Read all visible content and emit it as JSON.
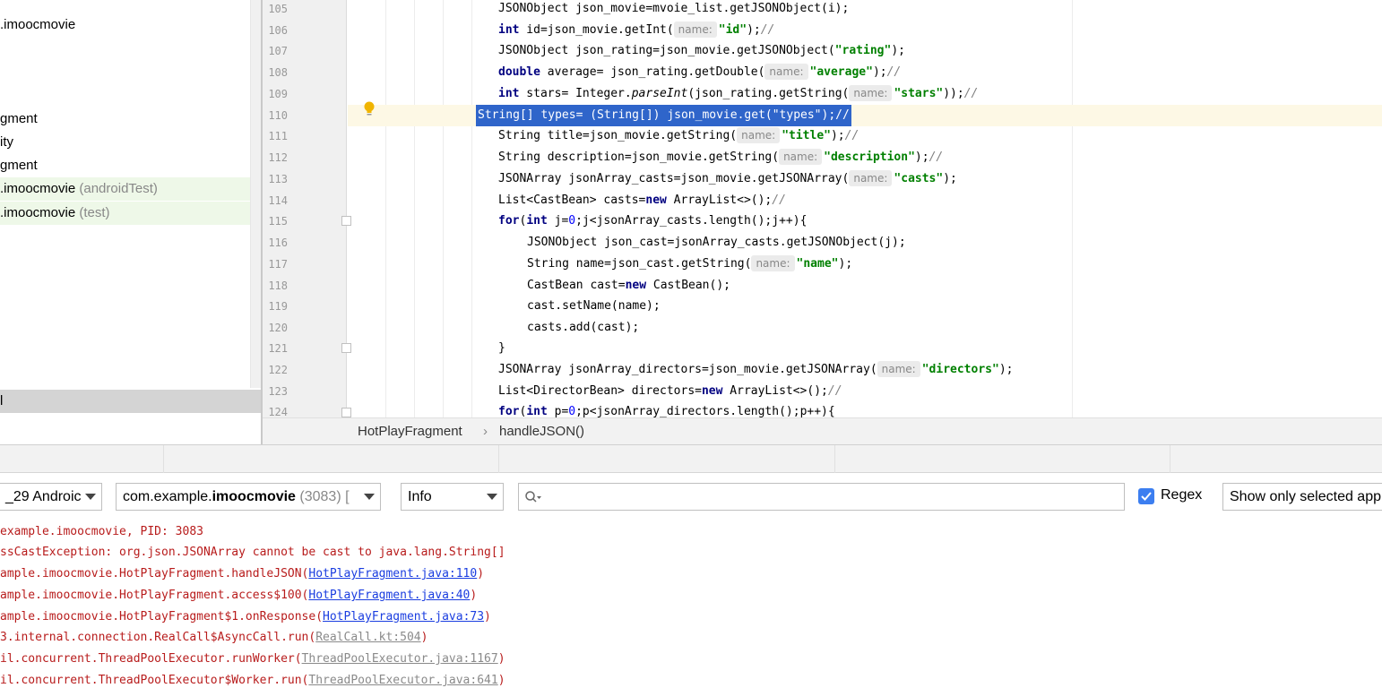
{
  "tree": {
    "items": [
      {
        "label": ".imoocmovie",
        "suffix": ""
      },
      {
        "label": "gment",
        "suffix": ""
      },
      {
        "label": "ity",
        "suffix": ""
      },
      {
        "label": "gment",
        "suffix": ""
      },
      {
        "label": ".imoocmovie",
        "suffix": " (androidTest)"
      },
      {
        "label": ".imoocmovie",
        "suffix": " (test)"
      }
    ],
    "selected_label": "l"
  },
  "editor": {
    "line_numbers": [
      "105",
      "106",
      "107",
      "108",
      "109",
      "110",
      "111",
      "112",
      "113",
      "114",
      "115",
      "116",
      "117",
      "118",
      "119",
      "120",
      "121",
      "122",
      "123",
      "124"
    ],
    "hint_name": "name:",
    "code": {
      "l105": "JSONObject json_movie=mvoie_list.getJSONObject(i);",
      "l106a": "int",
      "l106b": " id=json_movie.getInt(",
      "l106s": "\"id\"",
      "l106c": ");",
      "l106d": "//",
      "l107a": "JSONObject json_rating=json_movie.getJSONObject(",
      "l107s": "\"rating\"",
      "l107b": ");",
      "l108a": "double",
      "l108b": " average= json_rating.getDouble(",
      "l108s": "\"average\"",
      "l108c": ");",
      "l108d": "//",
      "l109a": "int",
      "l109b": " stars= Integer.",
      "l109i": "parseInt",
      "l109c": "(json_rating.getString(",
      "l109s": "\"stars\"",
      "l109d": "));",
      "l109e": "//",
      "l110": "String[] types= (String[]) json_movie.get(\"types\");//",
      "l111a": "String title=json_movie.getString(",
      "l111s": "\"title\"",
      "l111b": ");",
      "l111c": "//",
      "l112a": "String description=json_movie.getString(",
      "l112s": "\"description\"",
      "l112b": ");",
      "l112c": "//",
      "l113a": "JSONArray jsonArray_casts=json_movie.getJSONArray(",
      "l113s": "\"casts\"",
      "l113b": ");",
      "l114a": "List<CastBean> casts=",
      "l114k": "new",
      "l114b": " ArrayList<>();",
      "l114c": "//",
      "l115a": "for",
      "l115b": "(",
      "l115k": "int",
      "l115c": " j=",
      "l115n": "0",
      "l115d": ";j<jsonArray_casts.length();j++){",
      "l116": "JSONObject json_cast=jsonArray_casts.getJSONObject(j);",
      "l117a": "String name=json_cast.getString(",
      "l117s": "\"name\"",
      "l117b": ");",
      "l118a": "CastBean cast=",
      "l118k": "new",
      "l118b": " CastBean();",
      "l119": "cast.setName(name);",
      "l120": "casts.add(cast);",
      "l121": "}",
      "l122a": "JSONArray jsonArray_directors=json_movie.getJSONArray(",
      "l122s": "\"directors\"",
      "l122b": ");",
      "l123a": "List<DirectorBean> directors=",
      "l123k": "new",
      "l123b": " ArrayList<>();",
      "l123c": "//",
      "l124a": "for",
      "l124b": "(",
      "l124k": "int",
      "l124c": " p=",
      "l124n": "0",
      "l124d": ";p<jsonArray_directors.length();p++){"
    }
  },
  "breadcrumb": {
    "class_name": "HotPlayFragment",
    "separator": "›",
    "method_name": "handleJSON()"
  },
  "logcat": {
    "device_combo": "_29 Androic",
    "process_combo_prefix": "com.example.",
    "process_combo_bold": "imoocmovie",
    "process_combo_suffix": " (3083) [",
    "level_combo": "Info",
    "regex_label": "Regex",
    "show_only_label": "Show only selected app",
    "lines": [
      {
        "text": "example.imoocmovie, PID: 3083",
        "link": "",
        "tail": ""
      },
      {
        "text": "ssCastException: org.json.JSONArray cannot be cast to java.lang.String[]",
        "link": "",
        "tail": ""
      },
      {
        "text": "ample.imoocmovie.HotPlayFragment.handleJSON(",
        "link": "HotPlayFragment.java:110",
        "tail": ")"
      },
      {
        "text": "ample.imoocmovie.HotPlayFragment.access$100(",
        "link": "HotPlayFragment.java:40",
        "tail": ")"
      },
      {
        "text": "ample.imoocmovie.HotPlayFragment$1.onResponse(",
        "link": "HotPlayFragment.java:73",
        "tail": ")"
      },
      {
        "text": "3.internal.connection.RealCall$AsyncCall.run(",
        "link": "RealCall.kt:504",
        "tail": ")"
      },
      {
        "text": "il.concurrent.ThreadPoolExecutor.runWorker(",
        "link": "ThreadPoolExecutor.java:1167",
        "tail": ")"
      },
      {
        "text": "il.concurrent.ThreadPoolExecutor$Worker.run(",
        "link": "ThreadPoolExecutor.java:641",
        "tail": ")"
      }
    ]
  }
}
